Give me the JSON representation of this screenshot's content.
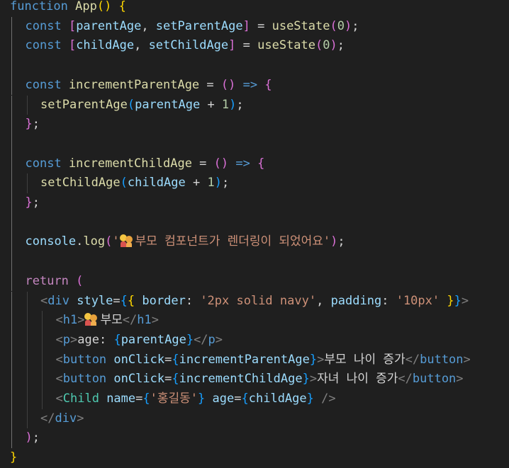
{
  "editor": {
    "language": "javascript",
    "lines": [
      {
        "indent": 0,
        "tokens": [
          {
            "t": "function",
            "c": "kw"
          },
          {
            "t": " "
          },
          {
            "t": "App",
            "c": "fn"
          },
          {
            "t": "(",
            "c": "br1"
          },
          {
            "t": ")",
            "c": "br1"
          },
          {
            "t": " "
          },
          {
            "t": "{",
            "c": "br1"
          }
        ]
      },
      {
        "indent": 1,
        "tokens": [
          {
            "t": "const",
            "c": "kw"
          },
          {
            "t": " "
          },
          {
            "t": "[",
            "c": "br2"
          },
          {
            "t": "parentAge",
            "c": "var"
          },
          {
            "t": ", "
          },
          {
            "t": "setParentAge",
            "c": "var"
          },
          {
            "t": "]",
            "c": "br2"
          },
          {
            "t": " = "
          },
          {
            "t": "useState",
            "c": "fn"
          },
          {
            "t": "(",
            "c": "br2"
          },
          {
            "t": "0",
            "c": "num"
          },
          {
            "t": ")",
            "c": "br2"
          },
          {
            "t": ";"
          }
        ]
      },
      {
        "indent": 1,
        "tokens": [
          {
            "t": "const",
            "c": "kw"
          },
          {
            "t": " "
          },
          {
            "t": "[",
            "c": "br2"
          },
          {
            "t": "childAge",
            "c": "var"
          },
          {
            "t": ", "
          },
          {
            "t": "setChildAge",
            "c": "var"
          },
          {
            "t": "]",
            "c": "br2"
          },
          {
            "t": " = "
          },
          {
            "t": "useState",
            "c": "fn"
          },
          {
            "t": "(",
            "c": "br2"
          },
          {
            "t": "0",
            "c": "num"
          },
          {
            "t": ")",
            "c": "br2"
          },
          {
            "t": ";"
          }
        ]
      },
      {
        "indent": 1,
        "tokens": []
      },
      {
        "indent": 1,
        "tokens": [
          {
            "t": "const",
            "c": "kw"
          },
          {
            "t": " "
          },
          {
            "t": "incrementParentAge",
            "c": "fn"
          },
          {
            "t": " = "
          },
          {
            "t": "()",
            "c": "br2"
          },
          {
            "t": " "
          },
          {
            "t": "=>",
            "c": "kw"
          },
          {
            "t": " "
          },
          {
            "t": "{",
            "c": "br2"
          }
        ]
      },
      {
        "indent": 2,
        "tokens": [
          {
            "t": "setParentAge",
            "c": "fn"
          },
          {
            "t": "(",
            "c": "br3"
          },
          {
            "t": "parentAge",
            "c": "var"
          },
          {
            "t": " + "
          },
          {
            "t": "1",
            "c": "num"
          },
          {
            "t": ")",
            "c": "br3"
          },
          {
            "t": ";"
          }
        ]
      },
      {
        "indent": 1,
        "tokens": [
          {
            "t": "}",
            "c": "br2"
          },
          {
            "t": ";"
          }
        ]
      },
      {
        "indent": 1,
        "tokens": []
      },
      {
        "indent": 1,
        "tokens": [
          {
            "t": "const",
            "c": "kw"
          },
          {
            "t": " "
          },
          {
            "t": "incrementChildAge",
            "c": "fn"
          },
          {
            "t": " = "
          },
          {
            "t": "()",
            "c": "br2"
          },
          {
            "t": " "
          },
          {
            "t": "=>",
            "c": "kw"
          },
          {
            "t": " "
          },
          {
            "t": "{",
            "c": "br2"
          }
        ]
      },
      {
        "indent": 2,
        "tokens": [
          {
            "t": "setChildAge",
            "c": "fn"
          },
          {
            "t": "(",
            "c": "br3"
          },
          {
            "t": "childAge",
            "c": "var"
          },
          {
            "t": " + "
          },
          {
            "t": "1",
            "c": "num"
          },
          {
            "t": ")",
            "c": "br3"
          },
          {
            "t": ";"
          }
        ]
      },
      {
        "indent": 1,
        "tokens": [
          {
            "t": "}",
            "c": "br2"
          },
          {
            "t": ";"
          }
        ]
      },
      {
        "indent": 1,
        "tokens": []
      },
      {
        "indent": 1,
        "tokens": [
          {
            "t": "console",
            "c": "var"
          },
          {
            "t": "."
          },
          {
            "t": "log",
            "c": "fn"
          },
          {
            "t": "(",
            "c": "br2"
          },
          {
            "t": "'",
            "c": "str"
          },
          {
            "t": "",
            "c": "emoji"
          },
          {
            "t": "부모 컴포넌트가 렌더링이 되었어요'",
            "c": "str"
          },
          {
            "t": ")",
            "c": "br2"
          },
          {
            "t": ";"
          }
        ]
      },
      {
        "indent": 1,
        "tokens": []
      },
      {
        "indent": 1,
        "tokens": [
          {
            "t": "return",
            "c": "ctl"
          },
          {
            "t": " "
          },
          {
            "t": "(",
            "c": "br2"
          }
        ]
      },
      {
        "indent": 2,
        "tokens": [
          {
            "t": "<",
            "c": "ang"
          },
          {
            "t": "div",
            "c": "tag"
          },
          {
            "t": " "
          },
          {
            "t": "style",
            "c": "attr"
          },
          {
            "t": "="
          },
          {
            "t": "{",
            "c": "br3"
          },
          {
            "t": "{",
            "c": "br1"
          },
          {
            "t": " "
          },
          {
            "t": "border",
            "c": "attr"
          },
          {
            "t": ": "
          },
          {
            "t": "'2px solid navy'",
            "c": "str"
          },
          {
            "t": ", "
          },
          {
            "t": "padding",
            "c": "attr"
          },
          {
            "t": ": "
          },
          {
            "t": "'10px'",
            "c": "str"
          },
          {
            "t": " "
          },
          {
            "t": "}",
            "c": "br1"
          },
          {
            "t": "}",
            "c": "br3"
          },
          {
            "t": ">",
            "c": "ang"
          }
        ]
      },
      {
        "indent": 3,
        "tokens": [
          {
            "t": "<",
            "c": "ang"
          },
          {
            "t": "h1",
            "c": "tag"
          },
          {
            "t": ">",
            "c": "ang"
          },
          {
            "t": "",
            "c": "emoji"
          },
          {
            "t": "부모",
            "c": "txt"
          },
          {
            "t": "</",
            "c": "ang"
          },
          {
            "t": "h1",
            "c": "tag"
          },
          {
            "t": ">",
            "c": "ang"
          }
        ]
      },
      {
        "indent": 3,
        "tokens": [
          {
            "t": "<",
            "c": "ang"
          },
          {
            "t": "p",
            "c": "tag"
          },
          {
            "t": ">",
            "c": "ang"
          },
          {
            "t": "age: ",
            "c": "txt"
          },
          {
            "t": "{",
            "c": "br3"
          },
          {
            "t": "parentAge",
            "c": "var"
          },
          {
            "t": "}",
            "c": "br3"
          },
          {
            "t": "</",
            "c": "ang"
          },
          {
            "t": "p",
            "c": "tag"
          },
          {
            "t": ">",
            "c": "ang"
          }
        ]
      },
      {
        "indent": 3,
        "tokens": [
          {
            "t": "<",
            "c": "ang"
          },
          {
            "t": "button",
            "c": "tag"
          },
          {
            "t": " "
          },
          {
            "t": "onClick",
            "c": "attr"
          },
          {
            "t": "="
          },
          {
            "t": "{",
            "c": "br3"
          },
          {
            "t": "incrementParentAge",
            "c": "var"
          },
          {
            "t": "}",
            "c": "br3"
          },
          {
            "t": ">",
            "c": "ang"
          },
          {
            "t": "부모 나이 증가",
            "c": "txt"
          },
          {
            "t": "</",
            "c": "ang"
          },
          {
            "t": "button",
            "c": "tag"
          },
          {
            "t": ">",
            "c": "ang"
          }
        ]
      },
      {
        "indent": 3,
        "tokens": [
          {
            "t": "<",
            "c": "ang"
          },
          {
            "t": "button",
            "c": "tag"
          },
          {
            "t": " "
          },
          {
            "t": "onClick",
            "c": "attr"
          },
          {
            "t": "="
          },
          {
            "t": "{",
            "c": "br3"
          },
          {
            "t": "incrementChildAge",
            "c": "var"
          },
          {
            "t": "}",
            "c": "br3"
          },
          {
            "t": ">",
            "c": "ang"
          },
          {
            "t": "자녀 나이 증가",
            "c": "txt"
          },
          {
            "t": "</",
            "c": "ang"
          },
          {
            "t": "button",
            "c": "tag"
          },
          {
            "t": ">",
            "c": "ang"
          }
        ]
      },
      {
        "indent": 3,
        "tokens": [
          {
            "t": "<",
            "c": "ang"
          },
          {
            "t": "Child",
            "c": "comp"
          },
          {
            "t": " "
          },
          {
            "t": "name",
            "c": "attr"
          },
          {
            "t": "="
          },
          {
            "t": "{",
            "c": "br3"
          },
          {
            "t": "'홍길동'",
            "c": "str"
          },
          {
            "t": "}",
            "c": "br3"
          },
          {
            "t": " "
          },
          {
            "t": "age",
            "c": "attr"
          },
          {
            "t": "="
          },
          {
            "t": "{",
            "c": "br3"
          },
          {
            "t": "childAge",
            "c": "var"
          },
          {
            "t": "}",
            "c": "br3"
          },
          {
            "t": " "
          },
          {
            "t": "/>",
            "c": "ang"
          }
        ]
      },
      {
        "indent": 2,
        "tokens": [
          {
            "t": "</",
            "c": "ang"
          },
          {
            "t": "div",
            "c": "tag"
          },
          {
            "t": ">",
            "c": "ang"
          }
        ]
      },
      {
        "indent": 1,
        "tokens": [
          {
            "t": ")",
            "c": "br2"
          },
          {
            "t": ";"
          }
        ]
      },
      {
        "indent": 0,
        "tokens": [
          {
            "t": "}",
            "c": "br1"
          }
        ]
      }
    ]
  }
}
